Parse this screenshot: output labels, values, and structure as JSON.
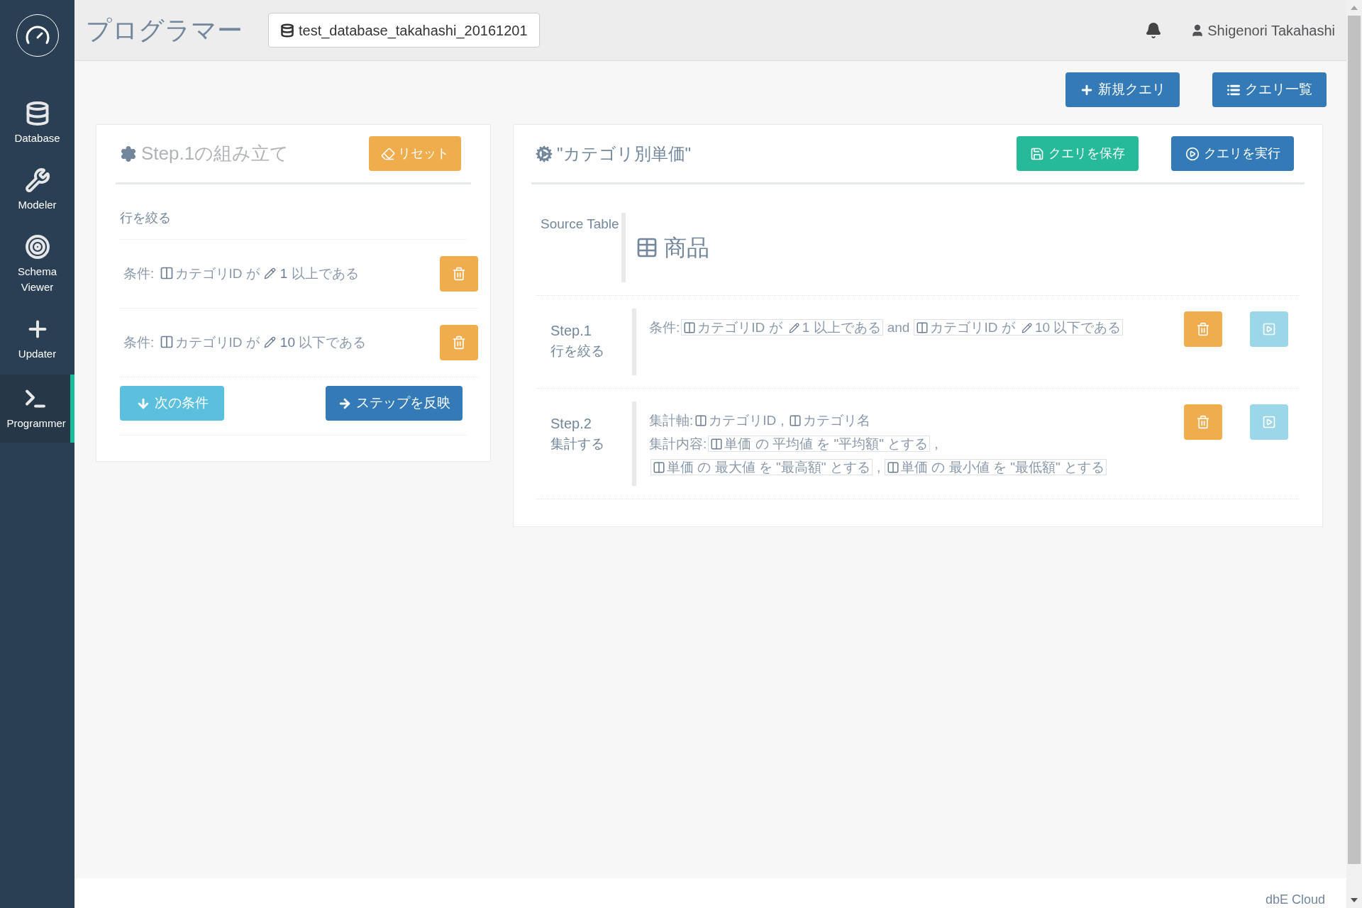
{
  "sidebar": {
    "items": [
      {
        "label": "Database",
        "selected": false
      },
      {
        "label": "Modeler",
        "selected": false
      },
      {
        "label": "Schema Viewer",
        "selected": false
      },
      {
        "label": "Updater",
        "selected": false
      },
      {
        "label": "Programmer",
        "selected": true
      }
    ]
  },
  "header": {
    "title": "プログラマー",
    "database": "test_database_takahashi_20161201",
    "user": "Shigenori Takahashi"
  },
  "toolbar": [
    "新規クエリ",
    "クエリ一覧"
  ],
  "builder": {
    "title": "Step.1の組み立て",
    "reset_button": "リセット",
    "section": "行を絞る",
    "conditions": [
      {
        "prefix": "条件:",
        "column": "カテゴリID",
        "op": "が",
        "value": "1",
        "tail": "以上である"
      },
      {
        "prefix": "条件:",
        "column": "カテゴリID",
        "op": "が",
        "value": "10",
        "tail": "以下である"
      }
    ],
    "next_button": "次の条件",
    "apply_button": "ステップを反映"
  },
  "query": {
    "title": "\"カテゴリ別単価\"",
    "save_button": "クエリを保存",
    "run_button": "クエリを実行",
    "source_label": "Source Table",
    "source_table": "商品",
    "steps": [
      {
        "name": "Step.1",
        "action": "行を絞る",
        "lines": [
          {
            "label": "条件:",
            "items": [
              {
                "kind": "chip",
                "column": "カテゴリID",
                "op": "が",
                "value": "1",
                "tail": "以上である"
              },
              {
                "kind": "text",
                "text": "and"
              },
              {
                "kind": "chip",
                "column": "カテゴリID",
                "op": "が",
                "value": "10",
                "tail": "以下である"
              }
            ]
          }
        ]
      },
      {
        "name": "Step.2",
        "action": "集計する",
        "lines": [
          {
            "label": "集計軸:",
            "items": [
              {
                "kind": "column",
                "column": "カテゴリID"
              },
              {
                "kind": "text",
                "text": ","
              },
              {
                "kind": "column",
                "column": "カテゴリ名"
              }
            ]
          },
          {
            "label": "集計内容:",
            "items": [
              {
                "kind": "chip",
                "column": "単価",
                "tail": "の 平均値 を \"平均額\" とする"
              },
              {
                "kind": "text",
                "text": ","
              },
              {
                "kind": "chip",
                "column": "単価",
                "tail": "の 最大値 を \"最高額\" とする"
              },
              {
                "kind": "text",
                "text": ","
              },
              {
                "kind": "chip",
                "column": "単価",
                "tail": "の 最小値 を \"最低額\" とする"
              }
            ]
          }
        ]
      }
    ]
  },
  "footer": "dbE Cloud"
}
